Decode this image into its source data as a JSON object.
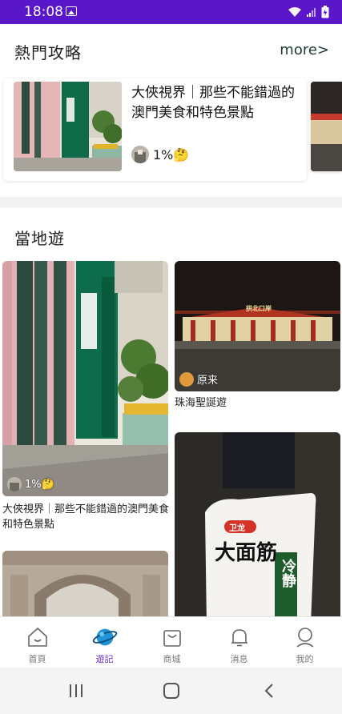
{
  "status_bar": {
    "time": "18:08"
  },
  "hot": {
    "title": "熱門攻略",
    "more": "more>",
    "card": {
      "title": "大俠視界｜那些不能錯過的澳門美食和特色景點",
      "meta": "1%🤔"
    }
  },
  "local": {
    "title": "當地遊",
    "cards": [
      {
        "caption": "大俠視界｜那些不能錯過的澳門美食和特色景點",
        "meta": "1%🤔"
      },
      {
        "caption": "珠海聖誕遊",
        "meta": "原来",
        "sign": "拱北口岸"
      },
      {
        "package_brand": "卫龙",
        "package_title": "大面筋",
        "package_sub": "冷静"
      }
    ]
  },
  "bottom_nav": {
    "items": [
      {
        "label": "首頁",
        "icon": "home-icon"
      },
      {
        "label": "遊記",
        "icon": "planet-icon"
      },
      {
        "label": "商城",
        "icon": "shopping-bag-icon"
      },
      {
        "label": "消息",
        "icon": "bell-icon"
      },
      {
        "label": "我的",
        "icon": "profile-icon"
      }
    ],
    "active_color": "#6a2bd0"
  },
  "colors": {
    "status_bar": "#5a16c9",
    "accent": "#6a2bd0"
  }
}
